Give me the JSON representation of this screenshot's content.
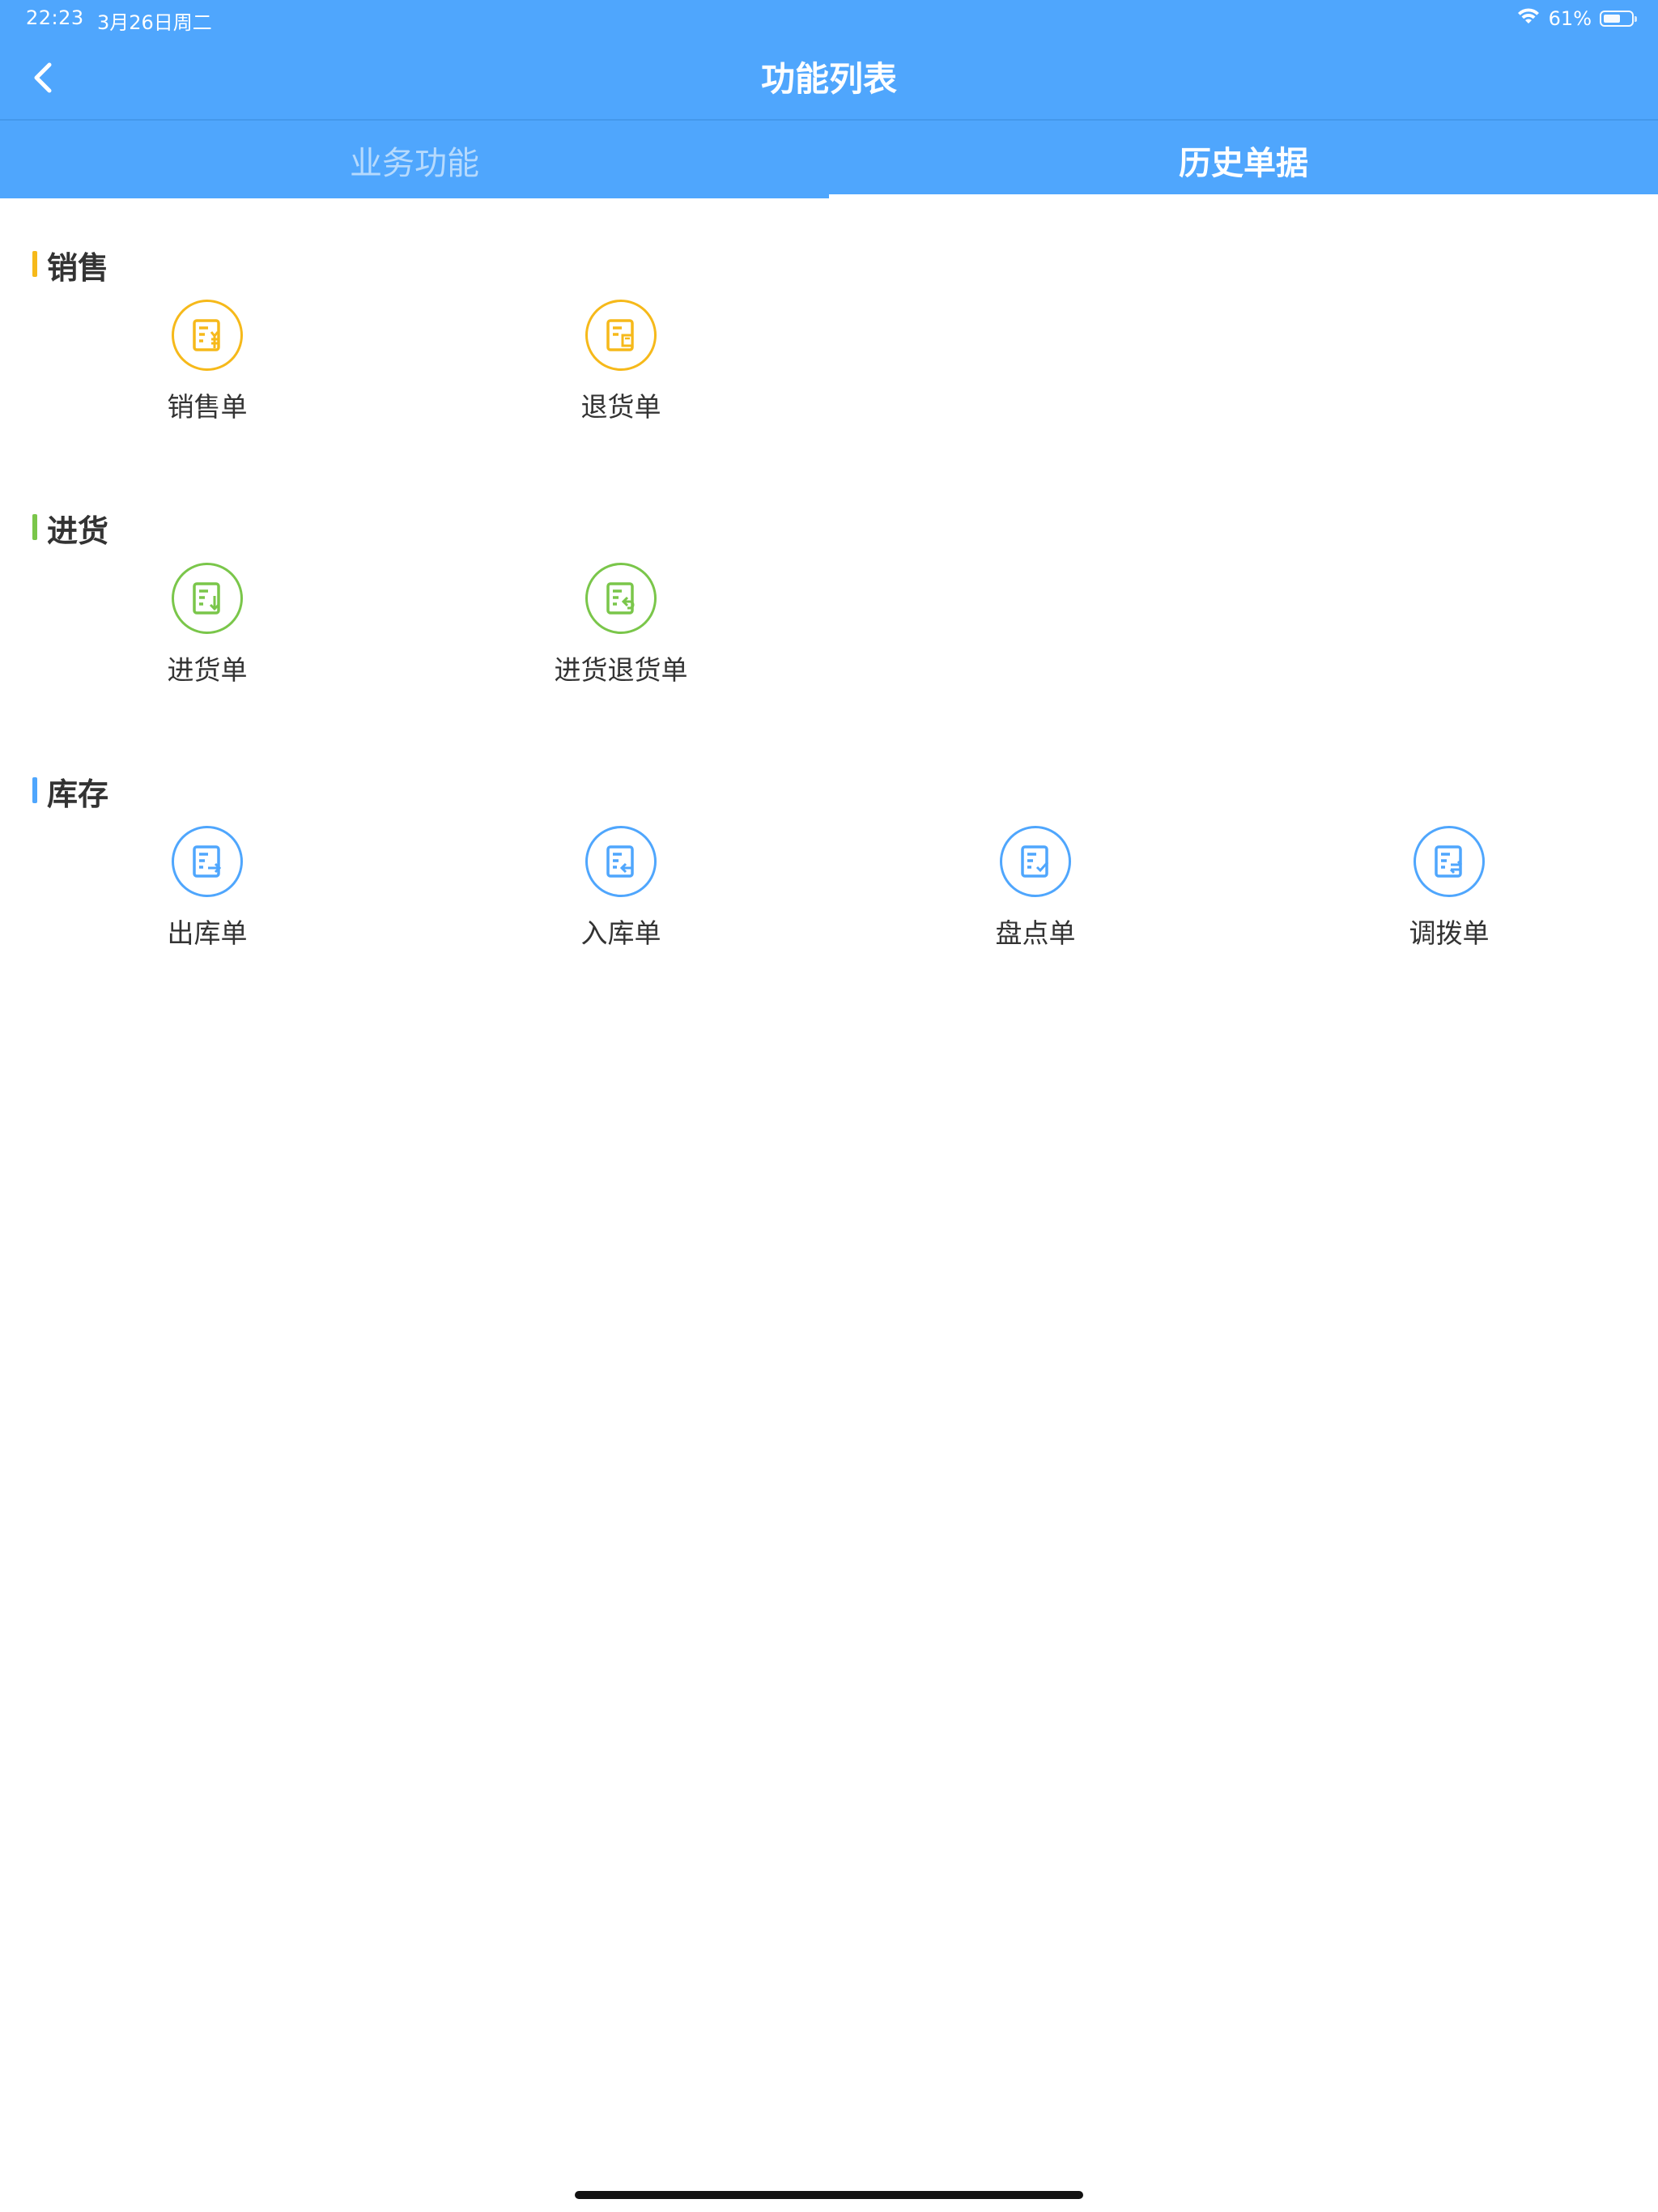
{
  "status_bar": {
    "time": "22:23",
    "date": "3月26日周二",
    "battery_text": "61%",
    "battery_level": 0.61
  },
  "nav": {
    "title": "功能列表",
    "back_icon": "chevron-left-icon"
  },
  "tabs": [
    {
      "label": "业务功能",
      "active": false
    },
    {
      "label": "历史单据",
      "active": true
    }
  ],
  "colors": {
    "primary": "#4fa6fd",
    "sales": "#f6b91a",
    "purchase": "#7ac64a",
    "inventory": "#4fa6fd"
  },
  "sections": [
    {
      "title": "销售",
      "items": [
        {
          "label": "销售单",
          "icon": "sales-order-icon"
        },
        {
          "label": "退货单",
          "icon": "return-order-icon"
        }
      ]
    },
    {
      "title": "进货",
      "items": [
        {
          "label": "进货单",
          "icon": "purchase-order-icon"
        },
        {
          "label": "进货退货单",
          "icon": "purchase-return-icon"
        }
      ]
    },
    {
      "title": "库存",
      "items": [
        {
          "label": "出库单",
          "icon": "stock-out-icon"
        },
        {
          "label": "入库单",
          "icon": "stock-in-icon"
        },
        {
          "label": "盘点单",
          "icon": "stocktake-icon"
        },
        {
          "label": "调拨单",
          "icon": "transfer-icon"
        }
      ]
    }
  ]
}
